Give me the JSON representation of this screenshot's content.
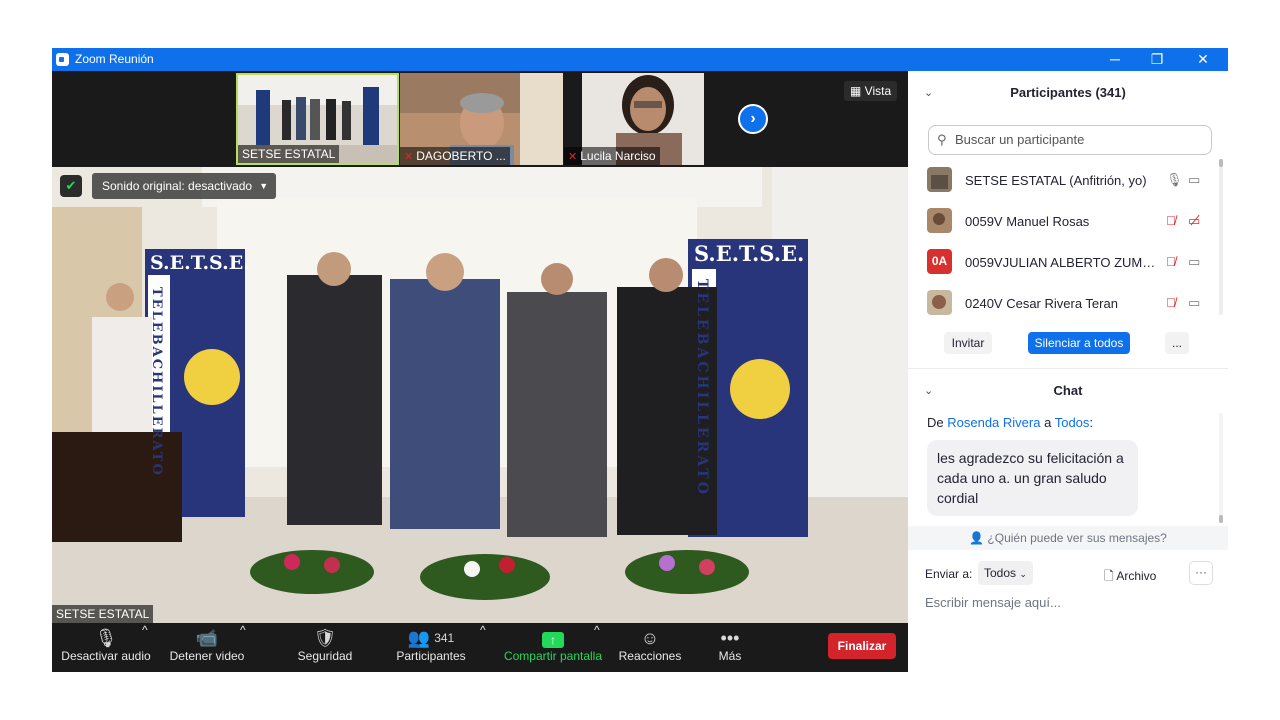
{
  "window": {
    "title": "Zoom Reunión",
    "controls": [
      "─",
      "❐",
      "✕"
    ]
  },
  "meeting": {
    "thumbnails": [
      {
        "name": "SETSE ESTATAL",
        "muted": false
      },
      {
        "name": "DAGOBERTO ...",
        "muted": true
      },
      {
        "name": "Lucila Narciso",
        "muted": true
      }
    ],
    "next_arrow": "›",
    "view_label": "Vista",
    "sound_label": "Sonido original: desactivado",
    "speaker": "SETSE ESTATAL",
    "banner_text": "S.E.T.S.E.",
    "banner_vertical": "TELEBACHILLERATO"
  },
  "toolbar": {
    "audio": "Desactivar audio",
    "video": "Detener video",
    "security": "Seguridad",
    "participants": "Participantes",
    "participants_count": "341",
    "share": "Compartir pantalla",
    "reactions": "Reacciones",
    "more": "Más",
    "end": "Finalizar"
  },
  "panel": {
    "title": "Participantes (341)",
    "search_placeholder": "Buscar un participante",
    "participants": [
      {
        "name": "SETSE ESTATAL (Anfitrión, yo)",
        "initials": "",
        "mic_muted": false,
        "cam_off": false
      },
      {
        "name": "0059V Manuel Rosas",
        "initials": "",
        "mic_muted": true,
        "cam_off": true
      },
      {
        "name": "0059VJULIAN ALBERTO ZUMAYA...",
        "initials": "0A",
        "mic_muted": true,
        "cam_off": false
      },
      {
        "name": "0240V Cesar Rivera Teran",
        "initials": "",
        "mic_muted": true,
        "cam_off": false
      }
    ],
    "invite": "Invitar",
    "mute_all": "Silenciar a todos",
    "more": "..."
  },
  "chat": {
    "title": "Chat",
    "from_prefix": "De",
    "sender": "Rosenda Rivera",
    "to_word": "a",
    "recipient": "Todos",
    "message": "les agradezco su felicitación a cada uno a. un gran saludo cordial",
    "who_can_see": "¿Quién puede ver sus mensajes?",
    "send_to": "Enviar a:",
    "send_to_value": "Todos",
    "file": "Archivo",
    "placeholder": "Escribir mensaje aquí..."
  },
  "colors": {
    "accent": "#0e71eb",
    "danger": "#d3242c",
    "share_green": "#23d959"
  }
}
